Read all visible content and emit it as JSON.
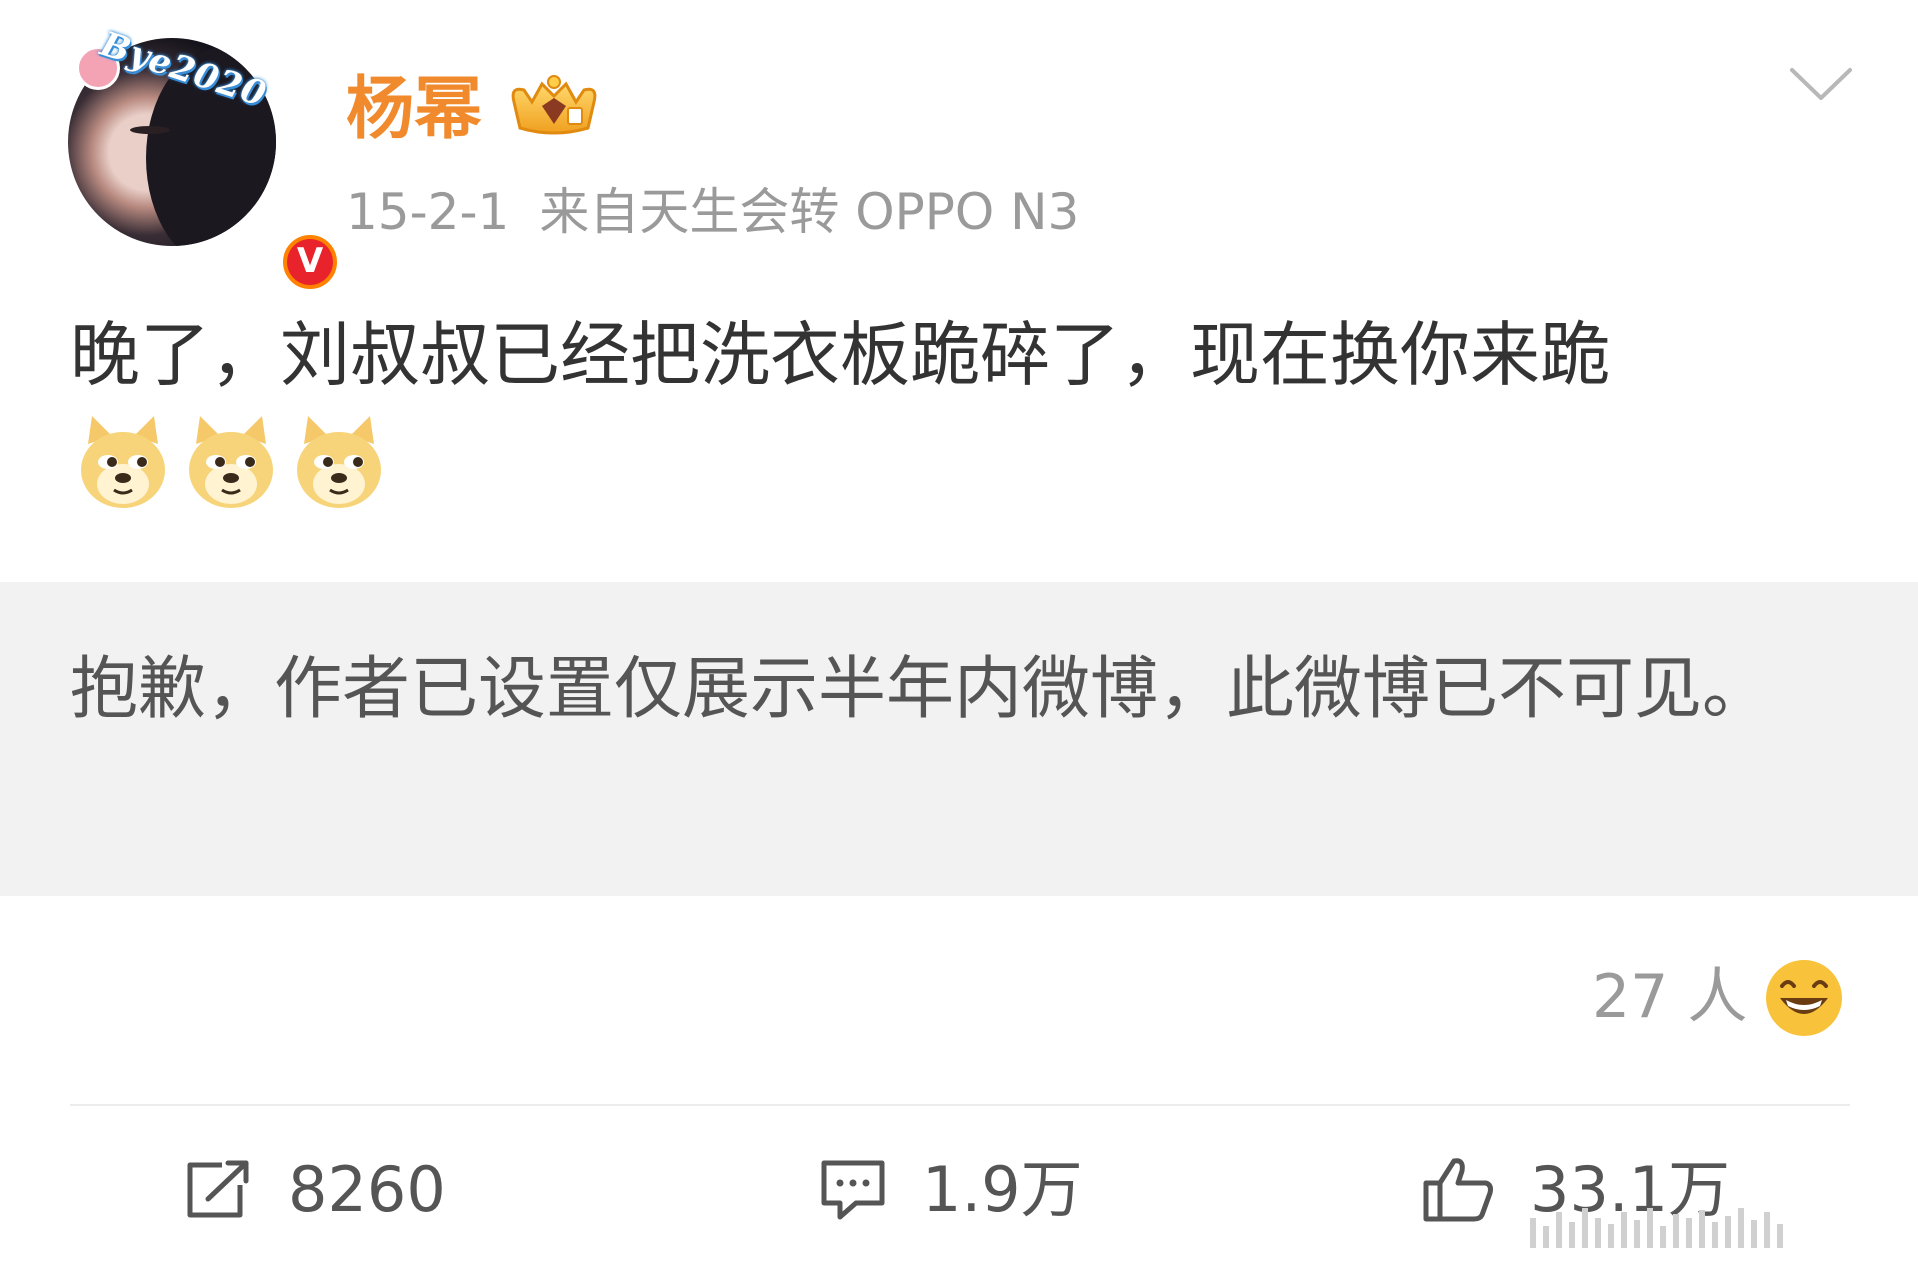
{
  "post": {
    "author": {
      "name": "杨幂",
      "avatar_tag": "Bye2020",
      "verified_mark": "V",
      "crown_icon": "vip-crown-icon"
    },
    "date": "15-2-1",
    "source": "来自天生会转 OPPO N3",
    "text": "晚了，刘叔叔已经把洗衣板跪碎了，现在换你来跪",
    "emojis": [
      "doge-emoji",
      "doge-emoji",
      "doge-emoji"
    ],
    "notice": "抱歉，作者已设置仅展示半年内微博，此微博已不可见。",
    "reaction": {
      "count_text": "27 人",
      "icon": "laugh-emoji"
    },
    "actions": {
      "repost_count": "8260",
      "comment_count": "1.9万",
      "like_count": "33.1万"
    }
  },
  "colors": {
    "username": "#f08a2c",
    "verified_badge": "#e8232b",
    "meta_text": "#9a9a9a",
    "body_text": "#333333",
    "notice_background": "#f2f2f2"
  }
}
